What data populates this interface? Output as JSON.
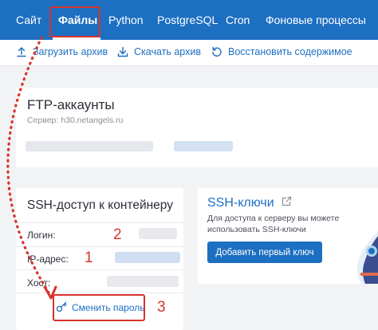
{
  "nav": {
    "tabs": [
      {
        "label": "Сайт"
      },
      {
        "label": "Файлы",
        "active": true
      },
      {
        "label": "Python"
      },
      {
        "label": "PostgreSQL"
      },
      {
        "label": "Cron"
      },
      {
        "label": "Фоновые процессы"
      }
    ]
  },
  "toolbar": {
    "upload_label": "Загрузить архив",
    "upload_icon": "upload-icon",
    "download_label": "Скачать архив",
    "download_icon": "download-icon",
    "restore_label": "Восстановить содержимое",
    "restore_icon": "restore-icon"
  },
  "ftp": {
    "title": "FTP-аккаунты",
    "server": "Сервер: h30.netangels.ru"
  },
  "ssh": {
    "title": "SSH-доступ к контейнеру",
    "login_label": "Логин:",
    "ip_label": "IP-адрес:",
    "host_label": "Хост:",
    "change_password": "Сменить пароль",
    "change_password_icon": "key-icon"
  },
  "ssh_keys": {
    "title": "SSH-ключи",
    "link_icon": "external-link-icon",
    "description": "Для доступа к серверу вы можете использовать SSH-ключи",
    "add_button": "Добавить первый ключ"
  },
  "annotations": {
    "step1": "1",
    "step2": "2",
    "step3": "3",
    "color": "#d9332b"
  },
  "colors": {
    "brand": "#1d6fc2",
    "background": "#f2f3f5",
    "blurred_text": "#d9dde3",
    "blurred_ip": "#c9daf0"
  }
}
